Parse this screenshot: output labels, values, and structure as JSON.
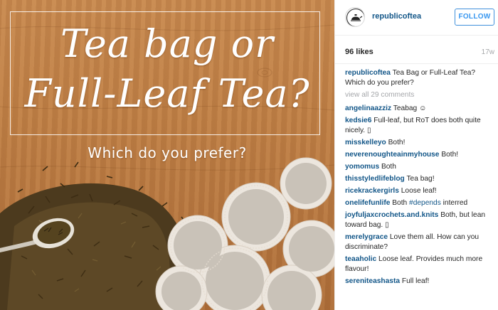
{
  "image": {
    "title_line1": "Tea bag or",
    "title_line2": "Full-Leaf Tea?",
    "subtitle": "Which do you prefer?",
    "colors": {
      "wood": "#bf7f45",
      "text": "#ffffff"
    }
  },
  "header": {
    "username": "republicoftea",
    "follow_label": "FOLLOW"
  },
  "meta": {
    "likes": "96 likes",
    "age": "17w"
  },
  "caption": {
    "user": "republicoftea",
    "text": "Tea Bag or Full-Leaf Tea? Which do you prefer?"
  },
  "view_all": "view all 29 comments",
  "comments": [
    {
      "user": "angelinaazziz",
      "text": "Teabag ☺"
    },
    {
      "user": "kedsie6",
      "text": "Full-leaf, but RoT does both quite nicely. ▯"
    },
    {
      "user": "misskelleyo",
      "text": "Both!"
    },
    {
      "user": "neverenoughteainmyhouse",
      "text": "Both!"
    },
    {
      "user": "yomomus",
      "text": "Both"
    },
    {
      "user": "thisstyledlifeblog",
      "text": "Tea bag!"
    },
    {
      "user": "ricekrackergirls",
      "text": "Loose leaf!"
    },
    {
      "user": "onelifefunlife",
      "pre": "Both",
      "tag": "#depends",
      "text": "interred"
    },
    {
      "user": "joyfuljaxcrochets.and.knits",
      "text": "Both, but lean toward bag. ▯"
    },
    {
      "user": "merelygrace",
      "text": "Love them all. How can you discriminate?"
    },
    {
      "user": "teaaholic",
      "text": "Loose leaf. Provides much more flavour!"
    },
    {
      "user": "sereniteashasta",
      "text": "Full leaf!"
    }
  ],
  "colors": {
    "link": "#125688",
    "follow": "#3897f0",
    "muted": "#a5a7aa"
  }
}
